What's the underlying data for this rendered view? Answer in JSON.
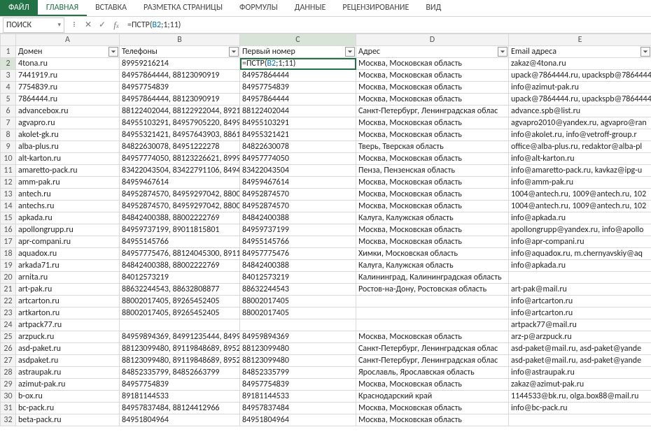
{
  "ribbon": {
    "file": "ФАЙЛ",
    "tabs": [
      "ГЛАВНАЯ",
      "ВСТАВКА",
      "РАЗМЕТКА СТРАНИЦЫ",
      "ФОРМУЛЫ",
      "ДАННЫЕ",
      "РЕЦЕНЗИРОВАНИЕ",
      "ВИД"
    ],
    "active_index": 0
  },
  "namebox": {
    "value": "ПОИСК"
  },
  "formula_bar": {
    "prefix": "=ПСТР(",
    "ref": "B2",
    "suffix": ";1;11)"
  },
  "columns": [
    "A",
    "B",
    "C",
    "D",
    "E"
  ],
  "headers": [
    "Домен",
    "Телефоны",
    "Первый номер",
    "Адрес",
    "Email адреса"
  ],
  "active_cell_display": "=ПСТР(B2;1;11)",
  "rows": [
    {
      "n": 2,
      "a": "4tona.ru",
      "b": "89959216214",
      "c": "__ACTIVE__",
      "d": "Москва, Московская область",
      "e": "zakaz@4tona.ru"
    },
    {
      "n": 3,
      "a": "7441919.ru",
      "b": "84957864444, 88123090919",
      "c": "84957864444",
      "d": "Москва, Московская область",
      "e": "upack@7864444.ru, upackspb@7864444"
    },
    {
      "n": 4,
      "a": "7754839.ru",
      "b": "84957754839",
      "c": "84957754839",
      "d": "Москва, Московская область",
      "e": "info@azimut-pak.ru"
    },
    {
      "n": 5,
      "a": "7864444.ru",
      "b": "84957864444, 88123090919",
      "c": "84957864444",
      "d": "Москва, Московская область",
      "e": "upack@7864444.ru, upackspb@7864444"
    },
    {
      "n": 6,
      "a": "advancebox.ru",
      "b": "88122402044, 88122922044, 8921",
      "c": "88122402044",
      "d": "Санкт-Петербург, Ленинградская облас",
      "e": "advance.spb@list.ru"
    },
    {
      "n": 7,
      "a": "agvapro.ru",
      "b": "84955103291, 84957905220, 8499",
      "c": "84955103291",
      "d": "Москва, Московская область",
      "e": "agvapro2010@yandex.ru, agvapro@ran"
    },
    {
      "n": 8,
      "a": "akolet-gk.ru",
      "b": "84955321421, 84957643903, 8861",
      "c": "84955321421",
      "d": "Москва, Московская область",
      "e": "info@akolet.ru, info@vetroff-group.r"
    },
    {
      "n": 9,
      "a": "alba-plus.ru",
      "b": "84822630078, 84951222278",
      "c": "84822630078",
      "d": "Тверь, Тверская область",
      "e": "office@alba-plus.ru, redaktor@alba-pl"
    },
    {
      "n": 10,
      "a": "alt-karton.ru",
      "b": "84957774050, 88123226621, 8999",
      "c": "84957774050",
      "d": "Москва, Московская область",
      "e": "info@alt-karton.ru"
    },
    {
      "n": 11,
      "a": "amaretto-pack.ru",
      "b": "83422043504, 83422791106, 8494",
      "c": "83422043504",
      "d": "Пенза, Пензенская область",
      "e": "info@amaretto-pack.ru, kavkaz@ipg-u"
    },
    {
      "n": 12,
      "a": "amm-pak.ru",
      "b": "84959467614",
      "c": "84959467614",
      "d": "Москва, Московская область",
      "e": "info@amm-pak.ru"
    },
    {
      "n": 13,
      "a": "antech.ru",
      "b": "84952874570, 84959297042, 8800",
      "c": "84952874570",
      "d": "Москва, Московская область",
      "e": "1004@antech.ru, 1009@antech.ru, 102"
    },
    {
      "n": 14,
      "a": "antechs.ru",
      "b": "84952874570, 84959297042, 8800",
      "c": "84952874570",
      "d": "Москва, Московская область",
      "e": "1004@antech.ru, 1009@antech.ru, 102"
    },
    {
      "n": 15,
      "a": "apkada.ru",
      "b": "84842400388, 88002222769",
      "c": "84842400388",
      "d": "Калуга, Калужская область",
      "e": "info@apkada.ru"
    },
    {
      "n": 16,
      "a": "apollongrupp.ru",
      "b": "84959737199, 89011815801",
      "c": "84959737199",
      "d": "Москва, Московская область",
      "e": "apollongrupp@yandex.ru, info@apollo"
    },
    {
      "n": 17,
      "a": "apr-compani.ru",
      "b": "84955145766",
      "c": "84955145766",
      "d": "Москва, Московская область",
      "e": "info@apr-compani.ru"
    },
    {
      "n": 18,
      "a": "aquadox.ru",
      "b": "84957775476, 88124045300, 8911",
      "c": "84957775476",
      "d": "Химки, Московская область",
      "e": "info@aquadox.ru, m.chernyavskiy@aq"
    },
    {
      "n": 19,
      "a": "arkada71.ru",
      "b": "84842400388, 88002222769",
      "c": "84842400388",
      "d": "Калуга, Калужская область",
      "e": "info@apkada.ru"
    },
    {
      "n": 20,
      "a": "arnita.ru",
      "b": "84012573219",
      "c": "84012573219",
      "d": "Калининград, Калининградская область",
      "e": ""
    },
    {
      "n": 21,
      "a": "art-pak.ru",
      "b": "88632244543, 88632808877",
      "c": "88632244543",
      "d": "Ростов-на-Дону, Ростовская область",
      "e": "art-pak@mail.ru"
    },
    {
      "n": 22,
      "a": "artcarton.ru",
      "b": "88002017405, 89265452405",
      "c": "88002017405",
      "d": "",
      "e": "info@artcarton.ru"
    },
    {
      "n": 23,
      "a": "artkarton.ru",
      "b": "88002017405, 89265452405",
      "c": "88002017405",
      "d": "",
      "e": "info@artcarton.ru"
    },
    {
      "n": 24,
      "a": "artpack77.ru",
      "b": "",
      "c": "",
      "d": "",
      "e": "artpack77@mail.ru"
    },
    {
      "n": 25,
      "a": "arzpuck.ru",
      "b": "84959894369, 84991235444, 8499",
      "c": "84959894369",
      "d": "Москва, Московская область",
      "e": "arz-p@arzpuck.ru"
    },
    {
      "n": 26,
      "a": "asd-paket.ru",
      "b": "88123099480, 89119848689, 8952",
      "c": "88123099480",
      "d": "Санкт-Петербург, Ленинградская облас",
      "e": "asd-paket@mail.ru, asd-paket@yande"
    },
    {
      "n": 27,
      "a": "asdpaket.ru",
      "b": "88123099480, 89119848689, 8952",
      "c": "88123099480",
      "d": "Санкт-Петербург, Ленинградская облас",
      "e": "asd-paket@mail.ru, asd-paket@yande"
    },
    {
      "n": 28,
      "a": "astraupak.ru",
      "b": "84852335799, 84852663799",
      "c": "84852335799",
      "d": "Ярославль, Ярославская область",
      "e": "info@astraupak.ru"
    },
    {
      "n": 29,
      "a": "azimut-pak.ru",
      "b": "84957754839",
      "c": "84957754839",
      "d": "Москва, Московская область",
      "e": "zakaz@azimut-pak.ru"
    },
    {
      "n": 30,
      "a": "b-ox.ru",
      "b": "89181144533",
      "c": "89181144533",
      "d": "Краснодарский край",
      "e": "1144533@bk.ru, olga.box88@mail.ru"
    },
    {
      "n": 31,
      "a": "bc-pack.ru",
      "b": "84957837484, 88124412966",
      "c": "84957837484",
      "d": "Москва, Московская область",
      "e": "info@bc-pack.ru"
    },
    {
      "n": 32,
      "a": "beta-pack.ru",
      "b": "84951804964",
      "c": "84951804964",
      "d": "Москва, Московская область",
      "e": ""
    }
  ]
}
